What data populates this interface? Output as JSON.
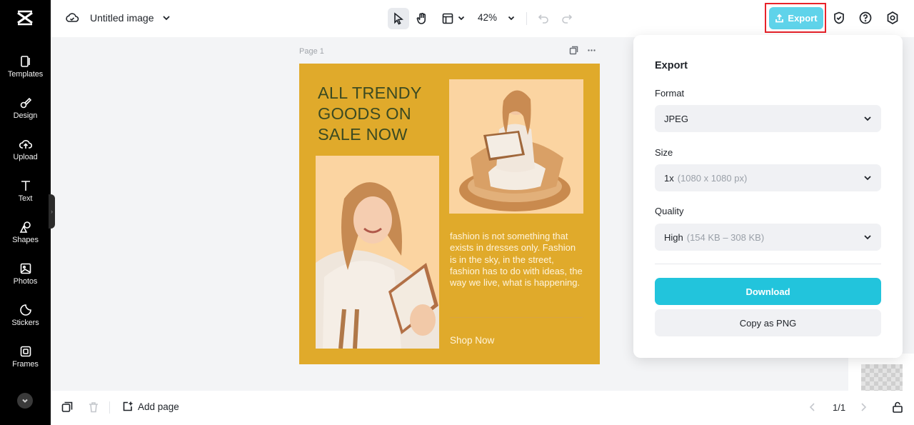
{
  "sidebar": {
    "items": [
      {
        "label": "Templates",
        "icon": "templates-icon"
      },
      {
        "label": "Design",
        "icon": "design-icon"
      },
      {
        "label": "Upload",
        "icon": "upload-icon"
      },
      {
        "label": "Text",
        "icon": "text-icon"
      },
      {
        "label": "Shapes",
        "icon": "shapes-icon"
      },
      {
        "label": "Photos",
        "icon": "photos-icon"
      },
      {
        "label": "Stickers",
        "icon": "stickers-icon"
      },
      {
        "label": "Frames",
        "icon": "frames-icon"
      }
    ]
  },
  "header": {
    "doc_title": "Untitled image",
    "zoom": "42%",
    "export_label": "Export"
  },
  "canvas": {
    "page_label": "Page 1",
    "design": {
      "headline": "ALL TRENDY GOODS ON SALE NOW",
      "body": "fashion is not something that exists in dresses only. Fashion is in the sky, in the street, fashion has to do with ideas, the way we live, what is happening.",
      "cta": "Shop Now"
    }
  },
  "export_panel": {
    "title": "Export",
    "format_label": "Format",
    "format_value": "JPEG",
    "size_label": "Size",
    "size_value": "1x",
    "size_detail": "(1080 x 1080 px)",
    "quality_label": "Quality",
    "quality_value": "High",
    "quality_detail": "(154 KB – 308 KB)",
    "download_label": "Download",
    "copy_label": "Copy as PNG"
  },
  "footer": {
    "add_page_label": "Add page",
    "page_indicator": "1/1"
  },
  "colors": {
    "accent": "#22c4dc",
    "export_button": "#5fd3ea",
    "design_background": "#e0aa2b",
    "highlight": "#e8222a"
  }
}
